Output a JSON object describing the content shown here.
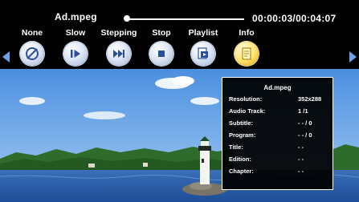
{
  "player": {
    "filename": "Ad.mpeg",
    "time": "00:00:03/00:04:07",
    "progress_fraction": 0.012
  },
  "controls": [
    {
      "label": "None",
      "icon": "repeat-none-icon"
    },
    {
      "label": "Slow",
      "icon": "slow-play-icon"
    },
    {
      "label": "Stepping",
      "icon": "step-forward-icon"
    },
    {
      "label": "Stop",
      "icon": "stop-icon"
    },
    {
      "label": "Playlist",
      "icon": "playlist-icon"
    },
    {
      "label": "Info",
      "icon": "info-icon"
    }
  ],
  "info_panel": {
    "title": "Ad.mpeg",
    "rows": [
      {
        "key": "Resolution:",
        "value": "352x288"
      },
      {
        "key": "Audio Track:",
        "value": "1 /1"
      },
      {
        "key": "Subtitle:",
        "value": "- - / 0"
      },
      {
        "key": "Program:",
        "value": "- - / 0"
      },
      {
        "key": "Title:",
        "value": "- -"
      },
      {
        "key": "Edition:",
        "value": "- -"
      },
      {
        "key": "Chapter:",
        "value": "- -"
      }
    ]
  },
  "colors": {
    "background": "#000000",
    "button_blue": "#dfe7f5",
    "info_button_yellow": "#ffe57a",
    "nav_arrow": "#6ea0e8"
  }
}
